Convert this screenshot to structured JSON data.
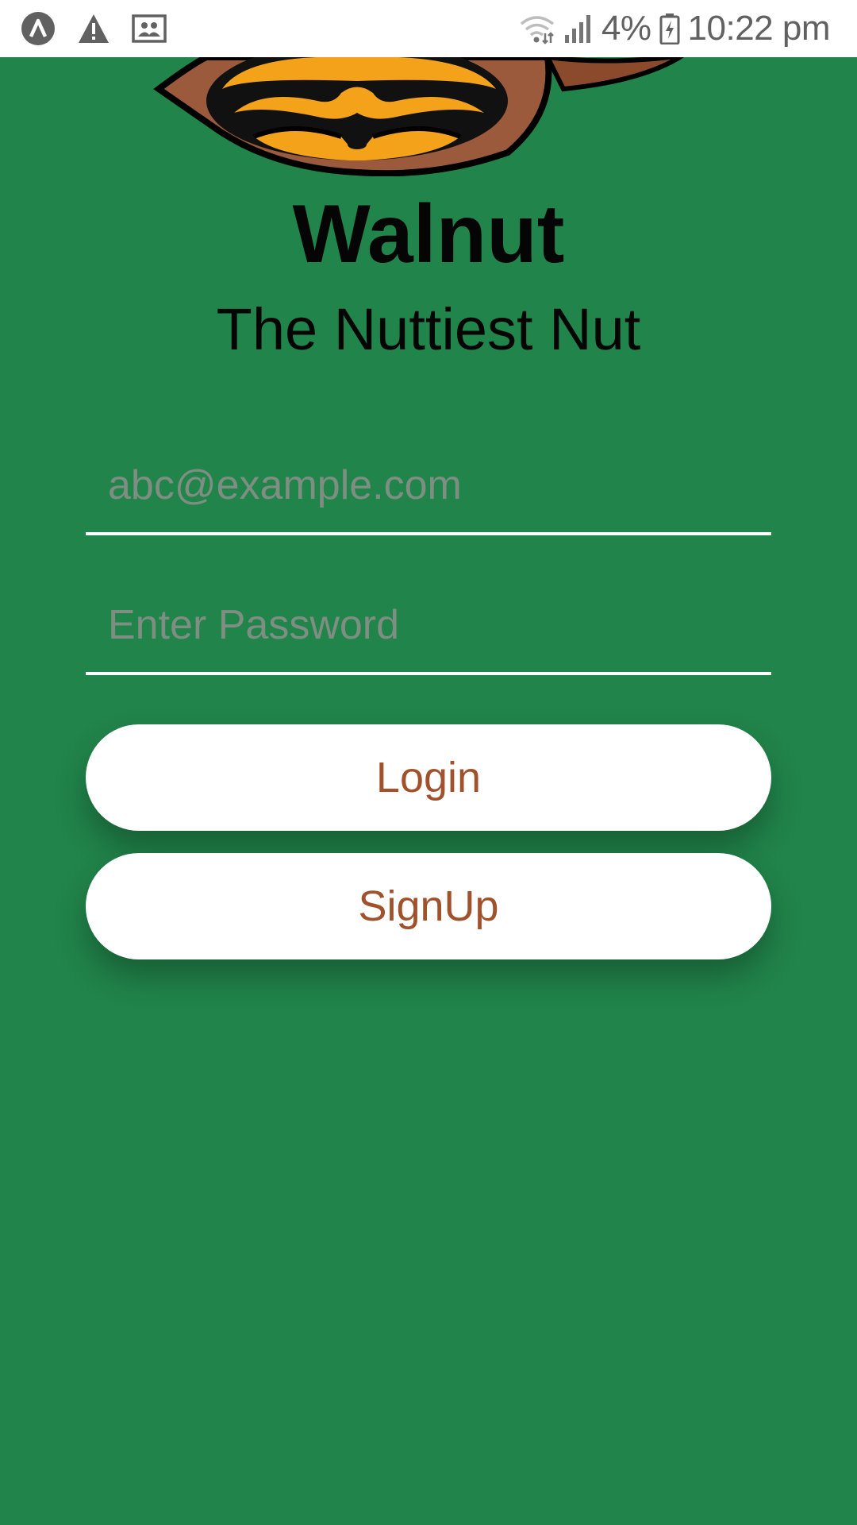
{
  "status_bar": {
    "left_icons": [
      "app-notification-icon",
      "warning-icon",
      "screen-cast-icon"
    ],
    "right_icons": [
      "wifi-icon",
      "signal-icon",
      "battery-charging-icon"
    ],
    "battery_percent": "4%",
    "time": "10:22 pm"
  },
  "app": {
    "logo_icon": "walnut-logo",
    "title": "Walnut",
    "subtitle": "The Nuttiest Nut"
  },
  "form": {
    "email_placeholder": "abc@example.com",
    "password_placeholder": "Enter Password",
    "login_label": "Login",
    "signup_label": "SignUp"
  },
  "colors": {
    "background": "#21844a",
    "button_text": "#a0522d",
    "button_background": "#ffffff",
    "placeholder": "#7f8e82"
  }
}
